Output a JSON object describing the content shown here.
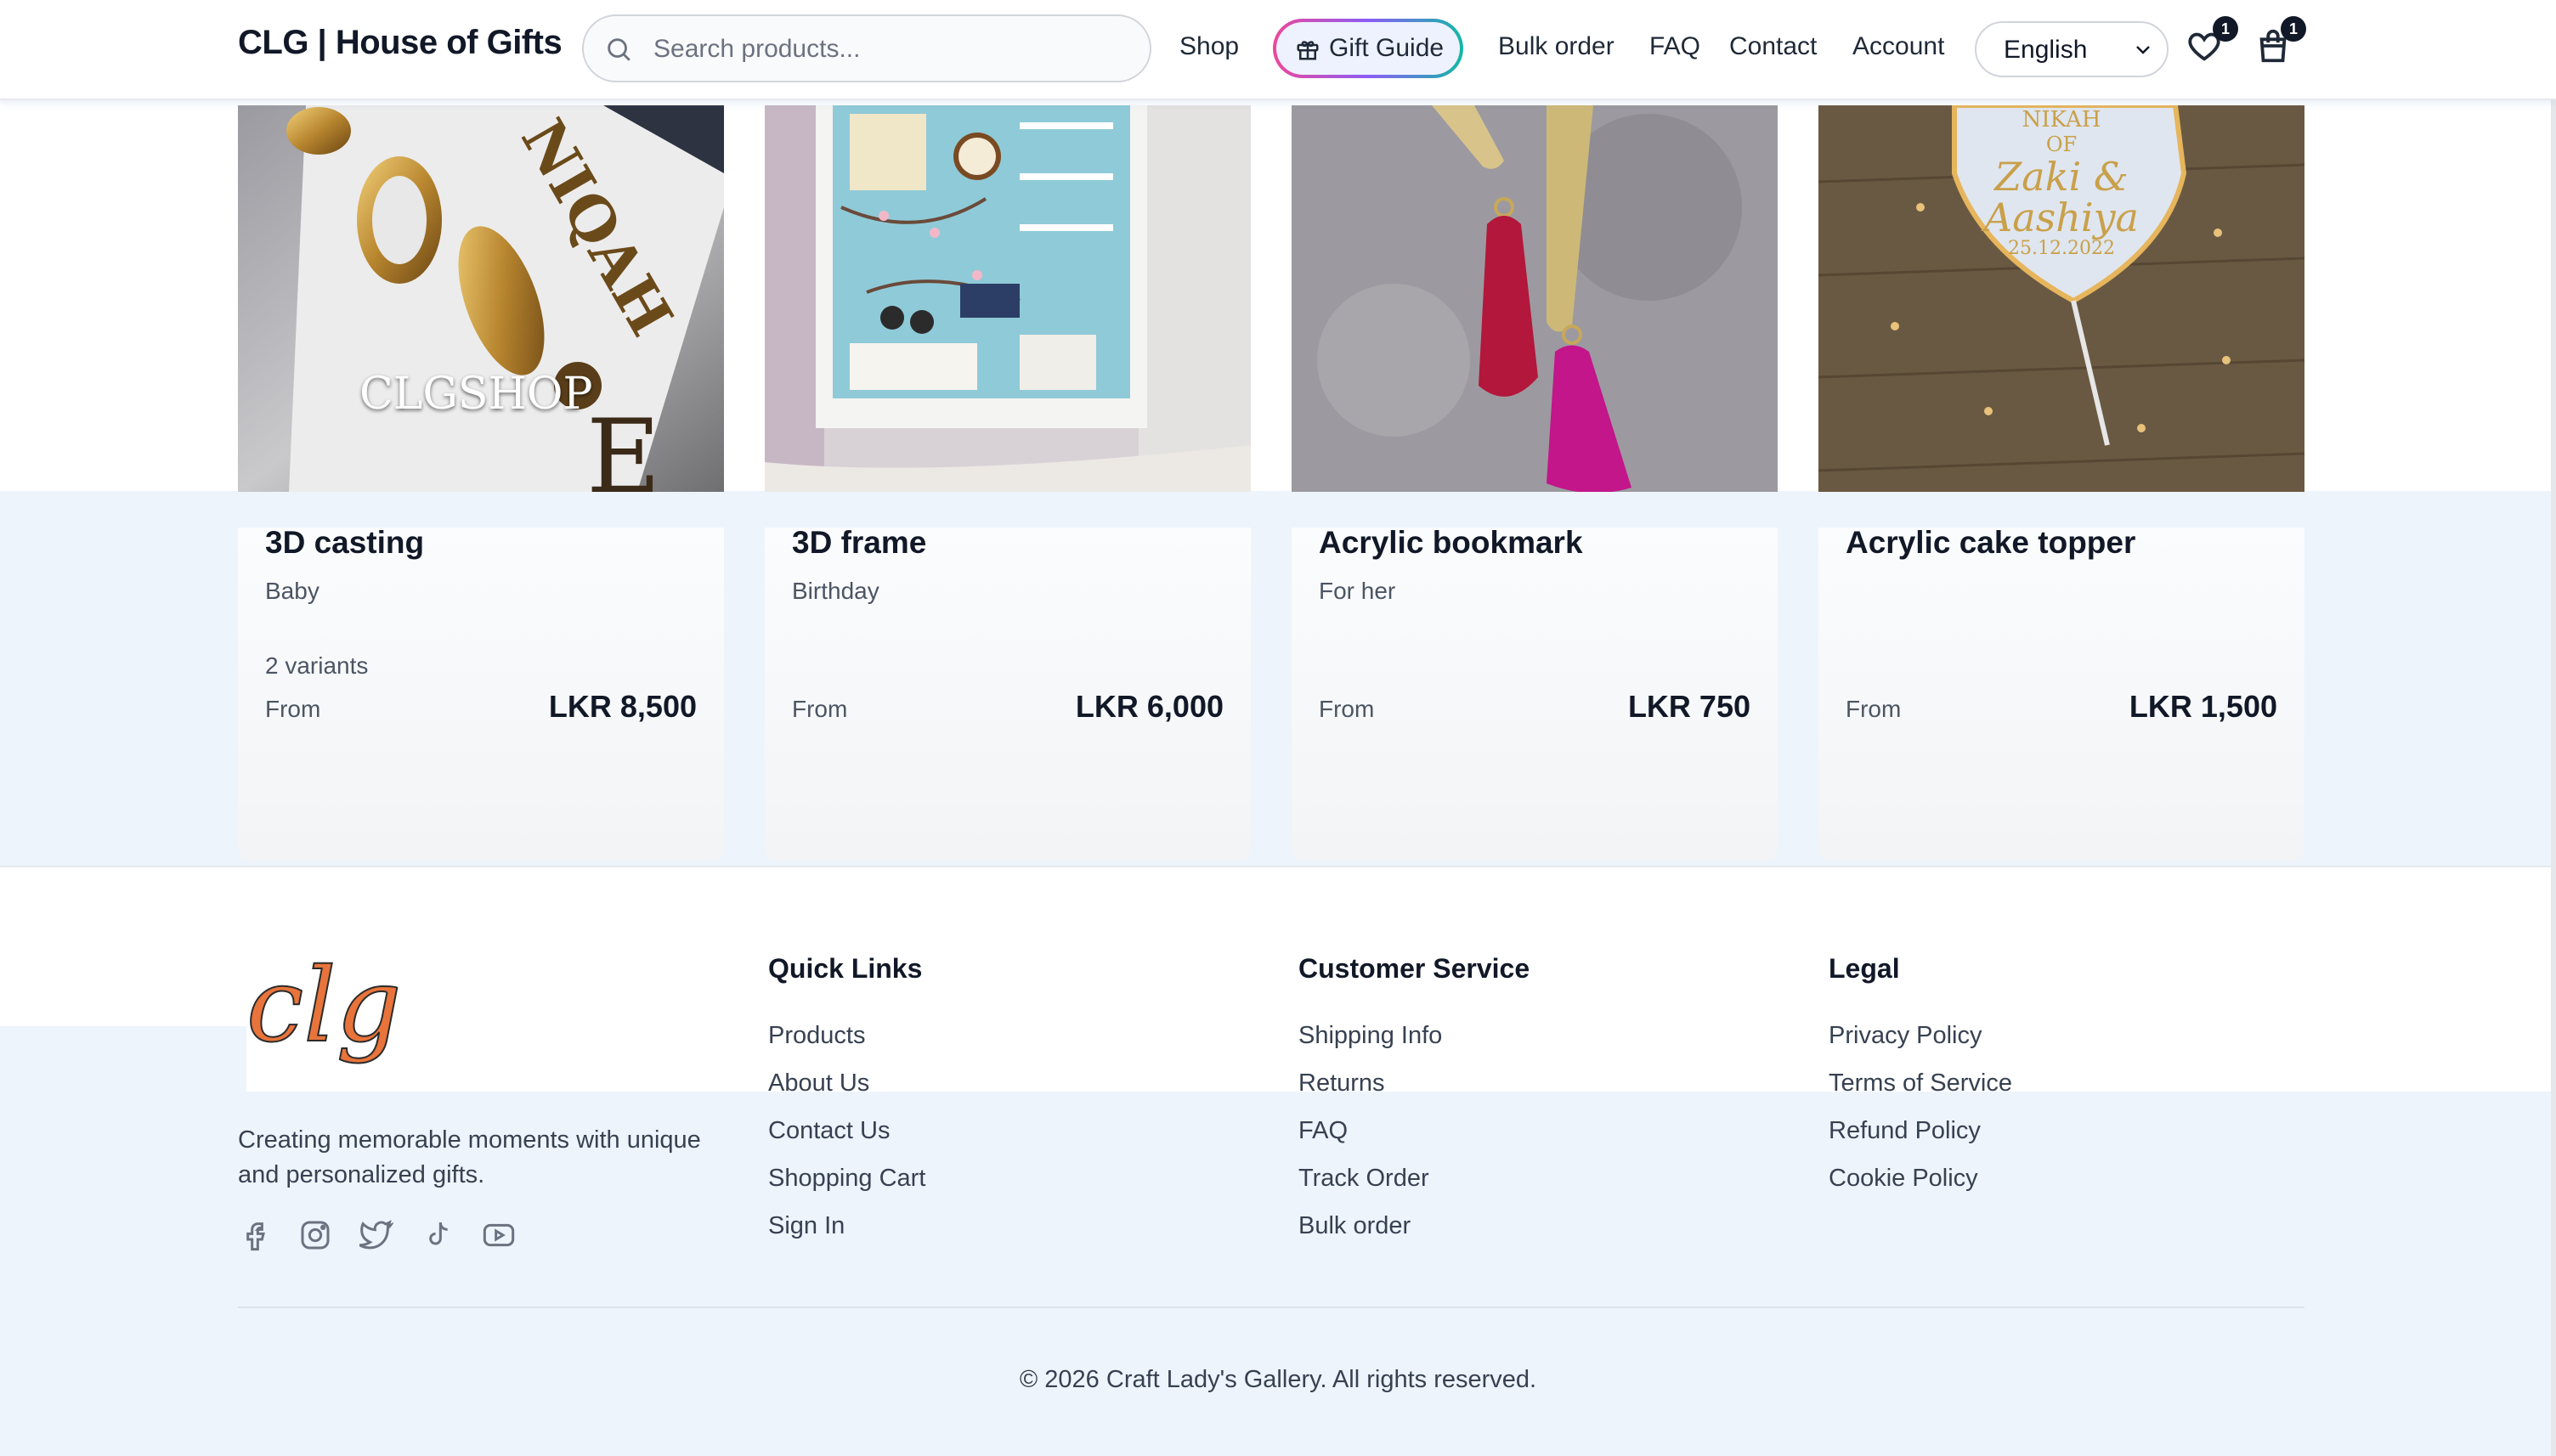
{
  "header": {
    "brand": "CLG | House of Gifts",
    "search_placeholder": "Search products...",
    "nav": {
      "shop": "Shop",
      "gift_guide": "Gift Guide",
      "bulk_order": "Bulk order",
      "faq": "FAQ",
      "contact": "Contact",
      "account": "Account"
    },
    "language": "English",
    "wishlist_count": "1",
    "cart_count": "1"
  },
  "products": [
    {
      "title": "3D casting",
      "category": "Baby",
      "variants": "2 variants",
      "from": "From",
      "price": "LKR 8,500",
      "watermark": "CLGSHOP"
    },
    {
      "title": "3D frame",
      "category": "Birthday",
      "variants": "",
      "from": "From",
      "price": "LKR 6,000"
    },
    {
      "title": "Acrylic bookmark",
      "category": "For her",
      "variants": "",
      "from": "From",
      "price": "LKR 750"
    },
    {
      "title": "Acrylic cake topper",
      "category": "",
      "variants": "",
      "from": "From",
      "price": "LKR 1,500",
      "topper_text": [
        "NIKAH",
        "OF",
        "Zaki &",
        "Aashiya",
        "25.12.2022"
      ]
    }
  ],
  "footer": {
    "logo_text": "clg",
    "tagline": "Creating memorable moments with unique and personalized gifts.",
    "social_icons": [
      "facebook-icon",
      "instagram-icon",
      "twitter-icon",
      "tiktok-icon",
      "youtube-icon"
    ],
    "quick_links": {
      "heading": "Quick Links",
      "items": [
        "Products",
        "About Us",
        "Contact Us",
        "Shopping Cart",
        "Sign In"
      ]
    },
    "customer_service": {
      "heading": "Customer Service",
      "items": [
        "Shipping Info",
        "Returns",
        "FAQ",
        "Track Order",
        "Bulk order"
      ]
    },
    "legal": {
      "heading": "Legal",
      "items": [
        "Privacy Policy",
        "Terms of Service",
        "Refund Policy",
        "Cookie Policy"
      ]
    },
    "copyright": "© 2026 Craft Lady's Gallery. All rights reserved."
  },
  "colors": {
    "accent_bg": "#eef4fc",
    "text_dark": "#111827",
    "text_muted": "#4b5563",
    "logo_orange": "#e8743b"
  }
}
